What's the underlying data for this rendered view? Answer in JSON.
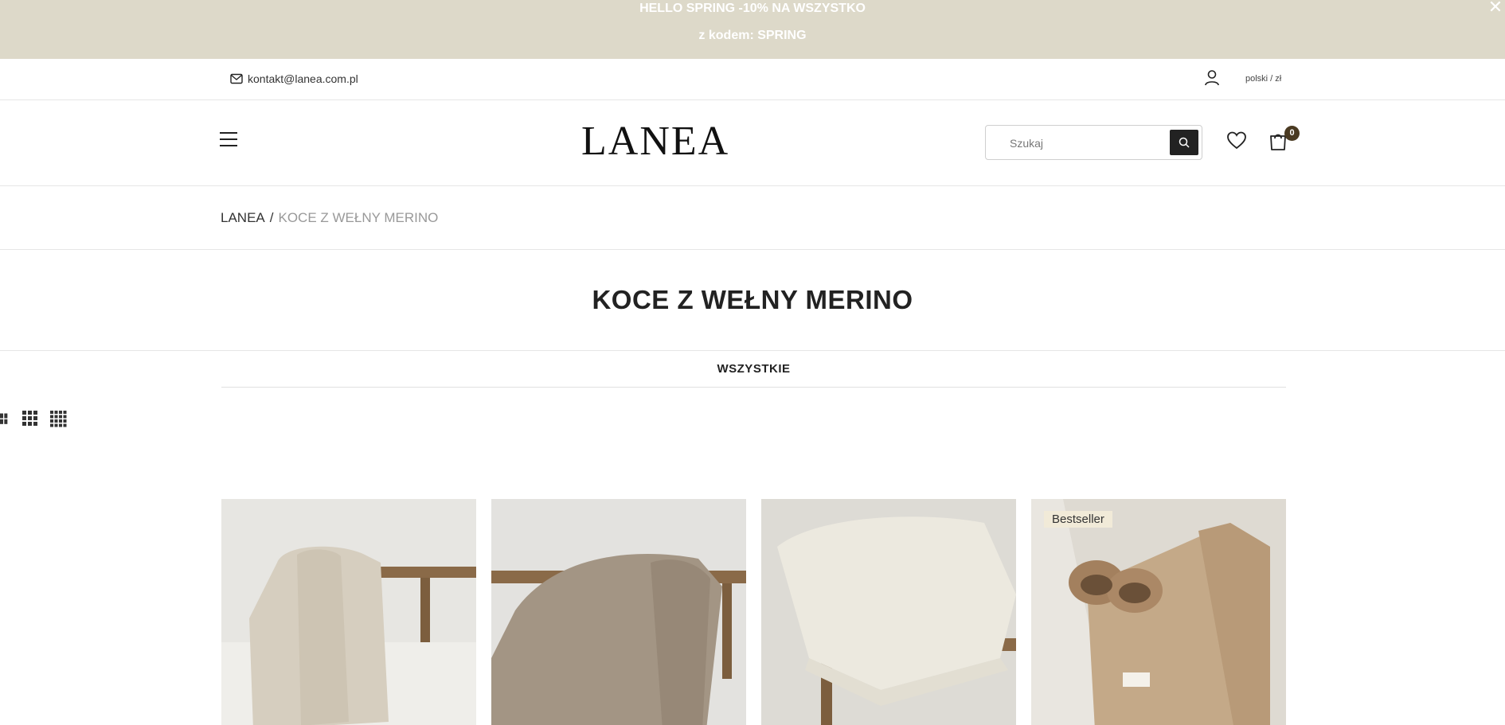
{
  "promo": {
    "line1": "HELLO SPRING -10% NA WSZYSTKO",
    "line2": "z kodem: SPRING",
    "close": "✕"
  },
  "topbar": {
    "email": "kontakt@lanea.com.pl",
    "lang_currency": "polski / zł"
  },
  "header": {
    "logo": "LANEA",
    "search_placeholder": "Szukaj",
    "cart_count": "0"
  },
  "breadcrumb": {
    "home": "LANEA",
    "separator": "/",
    "current": "KOCE Z WEŁNY MERINO"
  },
  "page_title": "KOCE Z WEŁNY MERINO",
  "filter": {
    "tabs": [
      {
        "label": "WSZYSTKIE",
        "active": true
      }
    ]
  },
  "grid_options": [
    "grid-2-icon",
    "grid-3-icon",
    "grid-4-icon"
  ],
  "products": [
    {
      "image": "beige waffle-knit blanket on wooden bench",
      "color": "#d6cebf",
      "badge": ""
    },
    {
      "image": "taupe waffle-knit blanket on wooden bench",
      "color": "#a39584",
      "badge": ""
    },
    {
      "image": "cream waffle-knit blanket on wooden stool",
      "color": "#ece9df",
      "badge": ""
    },
    {
      "image": "beige blanket with wool slippers on bed",
      "color": "#c4a988",
      "badge": "Bestseller"
    }
  ],
  "colors": {
    "promo_bg": "#ddd9c9",
    "accent_dark": "#222222",
    "cart_badge": "#4a3a22",
    "badge_bg": "#f1ead8"
  }
}
